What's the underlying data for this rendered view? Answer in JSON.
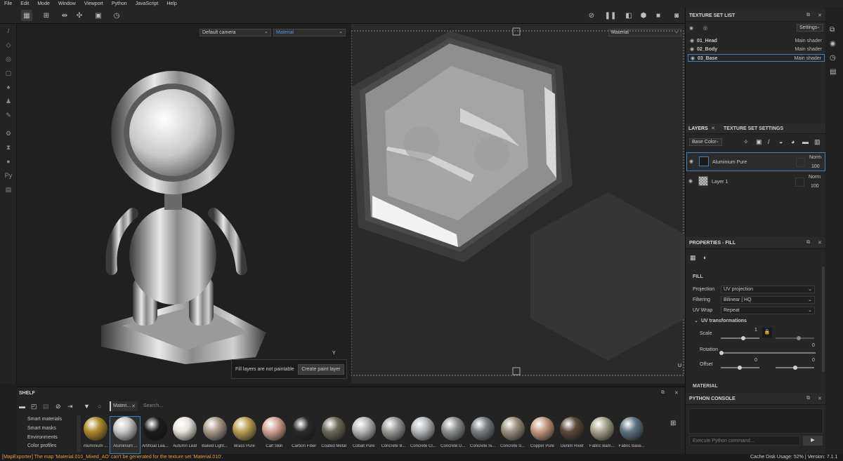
{
  "menu": [
    "File",
    "Edit",
    "Mode",
    "Window",
    "Viewport",
    "Python",
    "JavaScript",
    "Help"
  ],
  "viewport3d": {
    "camera": "Default camera",
    "channel": "Material",
    "axis_y": "Y"
  },
  "viewport2d": {
    "channel": "Material",
    "axis_u": "U"
  },
  "paint_hint": {
    "message": "Fill layers are not paintable",
    "button": "Create paint layer"
  },
  "texture_set_list": {
    "title": "TEXTURE SET LIST",
    "settings": "Settings",
    "items": [
      {
        "name": "01_Head",
        "shader": "Main shader"
      },
      {
        "name": "02_Body",
        "shader": "Main shader"
      },
      {
        "name": "03_Base",
        "shader": "Main shader"
      }
    ]
  },
  "layers": {
    "tab_layers": "LAYERS",
    "tab_settings": "TEXTURE SET SETTINGS",
    "channel": "Base Color",
    "items": [
      {
        "name": "Aluminium Pure",
        "blend": "Norm",
        "opacity": "100"
      },
      {
        "name": "Layer 1",
        "blend": "Norm",
        "opacity": "100"
      }
    ]
  },
  "properties": {
    "title": "PROPERTIES - FILL",
    "fill_header": "FILL",
    "projection_label": "Projection",
    "projection_value": "UV projection",
    "filtering_label": "Filtering",
    "filtering_value": "Bilinear | HQ",
    "uvwrap_label": "UV Wrap",
    "uvwrap_value": "Repeat",
    "uvtrans_header": "UV transformations",
    "scale_label": "Scale",
    "scale_value": "1",
    "rotation_label": "Rotation",
    "rotation_value": "0",
    "offset_label": "Offset",
    "offset_x": "0",
    "offset_y": "0",
    "material_header": "MATERIAL"
  },
  "python_console": {
    "title": "PYTHON CONSOLE",
    "placeholder": "Execute Python command..."
  },
  "shelf": {
    "title": "SHELF",
    "tab": "Materi...",
    "search_placeholder": "Search...",
    "categories": [
      "Smart materials",
      "Smart masks",
      "Environments",
      "Color profiles"
    ],
    "materials": [
      {
        "name": "Aluminium ...",
        "color": "#b08a2a"
      },
      {
        "name": "Aluminium ...",
        "color": "#c8c8c8"
      },
      {
        "name": "Artificial Lea...",
        "color": "#1c1c1c"
      },
      {
        "name": "Autumn Leaf",
        "color": "#e8e4dc"
      },
      {
        "name": "Baked Light...",
        "color": "#a89a88"
      },
      {
        "name": "Brass Pure",
        "color": "#b9a055"
      },
      {
        "name": "Calf Skin",
        "color": "#d2a393"
      },
      {
        "name": "Carbon Fiber",
        "color": "#2a2a2a"
      },
      {
        "name": "Coated Metal",
        "color": "#6e6a5a"
      },
      {
        "name": "Cobalt Pure",
        "color": "#b8b8b8"
      },
      {
        "name": "Concrete B...",
        "color": "#9a9a98"
      },
      {
        "name": "Concrete Cl...",
        "color": "#b4b8bc"
      },
      {
        "name": "Concrete D...",
        "color": "#8f9090"
      },
      {
        "name": "Concrete Si...",
        "color": "#7a7f83"
      },
      {
        "name": "Concrete S...",
        "color": "#9b9080"
      },
      {
        "name": "Copper Pure",
        "color": "#c49a80"
      },
      {
        "name": "Denim Rivet",
        "color": "#5a4a3a"
      },
      {
        "name": "Fabric Bam...",
        "color": "#a8a48e"
      },
      {
        "name": "Fabric Base...",
        "color": "#5e7480"
      }
    ]
  },
  "status": {
    "message": "[MapExporter] The map 'Material.010_Mixed_AO' can't be generated for the texture set 'Material.010'.",
    "disk_usage": "Cache Disk Usage:    52% | Version: 7.1.1",
    "message_color": "#e0a23a"
  }
}
